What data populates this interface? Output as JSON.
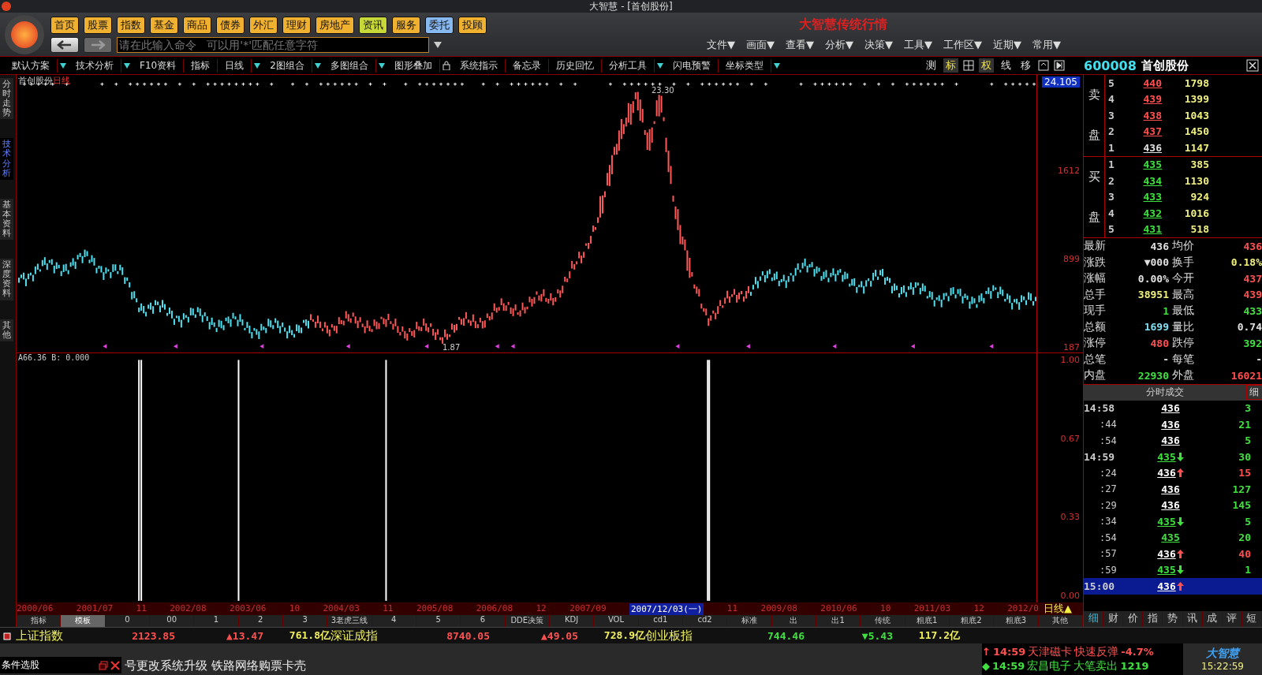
{
  "window": {
    "title": "大智慧 - [首创股份]"
  },
  "banner": "大智慧传统行情",
  "nav": [
    {
      "label": "首页",
      "color": "#f0b030"
    },
    {
      "label": "股票",
      "color": "#f0b030"
    },
    {
      "label": "指数",
      "color": "#f0b030"
    },
    {
      "label": "基金",
      "color": "#f0b030"
    },
    {
      "label": "商品",
      "color": "#f0b030"
    },
    {
      "label": "债券",
      "color": "#f0b030"
    },
    {
      "label": "外汇",
      "color": "#f0b030"
    },
    {
      "label": "理财",
      "color": "#f0b030"
    },
    {
      "label": "房地产",
      "color": "#f0b030"
    },
    {
      "label": "资讯",
      "color": "#c8d838"
    },
    {
      "label": "服务",
      "color": "#f0b030"
    },
    {
      "label": "委托",
      "color": "#88b8f0"
    },
    {
      "label": "投顾",
      "color": "#f0b030"
    }
  ],
  "command": {
    "placeholder": "请在此输入命令   可以用'*'匹配任意字符"
  },
  "menu": [
    "文件▼",
    "画面▼",
    "查看▼",
    "分析▼",
    "决策▼",
    "工具▼",
    "工作区▼",
    "近期▼",
    "常用▼"
  ],
  "toolbar": [
    {
      "label": "默认方案",
      "dropdown": true
    },
    {
      "label": "技术分析",
      "dropdown": true
    },
    {
      "label": "F10资料",
      "dropdown": false
    },
    {
      "label": "指标",
      "dropdown": false
    },
    {
      "label": "日线",
      "dropdown": true
    },
    {
      "label": "2图组合",
      "dropdown": true
    },
    {
      "label": "多图组合",
      "dropdown": true
    },
    {
      "label": "图形叠加",
      "dropdown": false
    },
    {
      "label": "系统指示",
      "dropdown": false
    },
    {
      "label": "备忘录",
      "dropdown": false
    },
    {
      "label": "历史回忆",
      "dropdown": false
    },
    {
      "label": "分析工具",
      "dropdown": true
    },
    {
      "label": "闪电预警",
      "dropdown": false
    },
    {
      "label": "坐标类型",
      "dropdown": true
    }
  ],
  "chart_tools": [
    {
      "label": "测",
      "selected": false
    },
    {
      "label": "标",
      "selected": true
    },
    {
      "label": "权",
      "selected": true
    },
    {
      "label": "线",
      "selected": false
    },
    {
      "label": "移",
      "selected": false
    }
  ],
  "side_tabs": [
    {
      "label": "分时走势",
      "selected": false
    },
    {
      "label": "技术分析",
      "selected": true
    },
    {
      "label": "基本资料",
      "selected": false
    },
    {
      "label": "深度资料",
      "selected": false
    },
    {
      "label": "其他",
      "selected": false
    }
  ],
  "chart": {
    "stock": "首创股份",
    "period": "日线",
    "high_label": "23.30",
    "low_label": "1.87",
    "price_box": "24.105",
    "price_ticks": [
      "1612",
      "899",
      "187"
    ]
  },
  "indicator": {
    "legend": "A66.36 B: 0.000",
    "ticks": [
      "1.00",
      "0.67",
      "0.33",
      "0.00"
    ]
  },
  "dates": [
    {
      "label": "2000/06",
      "selected": false
    },
    {
      "label": "2001/07",
      "selected": false
    },
    {
      "label": "11",
      "selected": false
    },
    {
      "label": "2002/08",
      "selected": false
    },
    {
      "label": "2003/06",
      "selected": false
    },
    {
      "label": "10",
      "selected": false
    },
    {
      "label": "2004/03",
      "selected": false
    },
    {
      "label": "11",
      "selected": false
    },
    {
      "label": "2005/08",
      "selected": false
    },
    {
      "label": "2006/08",
      "selected": false
    },
    {
      "label": "12",
      "selected": false
    },
    {
      "label": "2007/09",
      "selected": false
    },
    {
      "label": "2007/12/03(一)",
      "selected": true
    },
    {
      "label": "11",
      "selected": false
    },
    {
      "label": "2009/08",
      "selected": false
    },
    {
      "label": "2010/06",
      "selected": false
    },
    {
      "label": "10",
      "selected": false
    },
    {
      "label": "2011/03",
      "selected": false
    },
    {
      "label": "12",
      "selected": false
    },
    {
      "label": "2012/0",
      "selected": false
    }
  ],
  "period_label": "日线▲",
  "template_tabs": [
    {
      "label": "指标",
      "selected": false
    },
    {
      "label": "模板",
      "selected": true
    },
    {
      "label": "0",
      "selected": false
    },
    {
      "label": "00",
      "selected": false
    },
    {
      "label": "1",
      "selected": false
    },
    {
      "label": "2",
      "selected": false
    },
    {
      "label": "3",
      "selected": false
    },
    {
      "label": "3老虎三线",
      "selected": false
    },
    {
      "label": "4",
      "selected": false
    },
    {
      "label": "5",
      "selected": false
    },
    {
      "label": "6",
      "selected": false
    },
    {
      "label": "DDE决策",
      "selected": false
    },
    {
      "label": "KDJ",
      "selected": false
    },
    {
      "label": "VOL",
      "selected": false
    },
    {
      "label": "cd1",
      "selected": false
    },
    {
      "label": "cd2",
      "selected": false
    },
    {
      "label": "标准",
      "selected": false
    },
    {
      "label": "出",
      "selected": false
    },
    {
      "label": "出1",
      "selected": false
    },
    {
      "label": "传统",
      "selected": false
    },
    {
      "label": "粗底1",
      "selected": false
    },
    {
      "label": "粗底2",
      "selected": false
    },
    {
      "label": "粗底3",
      "selected": false
    },
    {
      "label": "其他",
      "selected": false
    }
  ],
  "panel": {
    "code": "600008",
    "name": "首创股份",
    "sell_label": [
      "卖",
      "盘"
    ],
    "buy_label": [
      "买",
      "盘"
    ],
    "sell": [
      {
        "level": "5",
        "price": "440",
        "volume": "1798",
        "kind": "up"
      },
      {
        "level": "4",
        "price": "439",
        "volume": "1399",
        "kind": "up"
      },
      {
        "level": "3",
        "price": "438",
        "volume": "1043",
        "kind": "up"
      },
      {
        "level": "2",
        "price": "437",
        "volume": "1450",
        "kind": "up"
      },
      {
        "level": "1",
        "price": "436",
        "volume": "1147",
        "kind": "flat"
      }
    ],
    "buy": [
      {
        "level": "1",
        "price": "435",
        "volume": "385",
        "kind": "down"
      },
      {
        "level": "2",
        "price": "434",
        "volume": "1130",
        "kind": "down"
      },
      {
        "level": "3",
        "price": "433",
        "volume": "924",
        "kind": "down"
      },
      {
        "level": "4",
        "price": "432",
        "volume": "1016",
        "kind": "down"
      },
      {
        "level": "5",
        "price": "431",
        "volume": "518",
        "kind": "down"
      }
    ],
    "stats": [
      {
        "left": {
          "label": "最新",
          "value": "436",
          "kind": "flat"
        },
        "right": {
          "label": "均价",
          "value": "436",
          "kind": "up"
        }
      },
      {
        "left": {
          "label": "涨跌",
          "value": "▼000",
          "kind": "flat"
        },
        "right": {
          "label": "换手",
          "value": "0.18%",
          "kind": "yellow"
        }
      },
      {
        "left": {
          "label": "涨幅",
          "value": "0.00%",
          "kind": "flat"
        },
        "right": {
          "label": "今开",
          "value": "437",
          "kind": "up"
        }
      },
      {
        "left": {
          "label": "总手",
          "value": "38951",
          "kind": "yellow"
        },
        "right": {
          "label": "最高",
          "value": "439",
          "kind": "up"
        }
      },
      {
        "left": {
          "label": "现手",
          "value": "1",
          "kind": "down"
        },
        "right": {
          "label": "最低",
          "value": "433",
          "kind": "down"
        }
      },
      {
        "left": {
          "label": "总额",
          "value": "1699",
          "kind": "cyan"
        },
        "right": {
          "label": "量比",
          "value": "0.74",
          "kind": "flat"
        }
      },
      {
        "left": {
          "label": "涨停",
          "value": "480",
          "kind": "up"
        },
        "right": {
          "label": "跌停",
          "value": "392",
          "kind": "down"
        }
      },
      {
        "left": {
          "label": "总笔",
          "value": "-",
          "kind": "flat"
        },
        "right": {
          "label": "每笔",
          "value": "-",
          "kind": "flat"
        }
      },
      {
        "left": {
          "label": "内盘",
          "value": "22930",
          "kind": "down"
        },
        "right": {
          "label": "外盘",
          "value": "16021",
          "kind": "up"
        }
      }
    ],
    "ticks_title": "分时成交",
    "ticks_btn": "细",
    "ticks": [
      {
        "time": "14:58",
        "full_time": true,
        "price": "436",
        "price_down": false,
        "rising": false,
        "falling": false,
        "volume": "3",
        "volume_up": false,
        "selected": false
      },
      {
        "time": ":44",
        "full_time": false,
        "price": "436",
        "price_down": false,
        "rising": false,
        "falling": false,
        "volume": "21",
        "volume_up": false,
        "selected": false
      },
      {
        "time": ":54",
        "full_time": false,
        "price": "436",
        "price_down": false,
        "rising": false,
        "falling": false,
        "volume": "5",
        "volume_up": false,
        "selected": false
      },
      {
        "time": "14:59",
        "full_time": true,
        "price": "435",
        "price_down": true,
        "rising": false,
        "falling": true,
        "volume": "30",
        "volume_up": false,
        "selected": false
      },
      {
        "time": ":24",
        "full_time": false,
        "price": "436",
        "price_down": false,
        "rising": true,
        "falling": false,
        "volume": "15",
        "volume_up": true,
        "selected": false
      },
      {
        "time": ":27",
        "full_time": false,
        "price": "436",
        "price_down": false,
        "rising": false,
        "falling": false,
        "volume": "127",
        "volume_up": false,
        "selected": false
      },
      {
        "time": ":29",
        "full_time": false,
        "price": "436",
        "price_down": false,
        "rising": false,
        "falling": false,
        "volume": "145",
        "volume_up": false,
        "selected": false
      },
      {
        "time": ":34",
        "full_time": false,
        "price": "435",
        "price_down": true,
        "rising": false,
        "falling": true,
        "volume": "5",
        "volume_up": false,
        "selected": false
      },
      {
        "time": ":54",
        "full_time": false,
        "price": "435",
        "price_down": true,
        "rising": false,
        "falling": false,
        "volume": "20",
        "volume_up": false,
        "selected": false
      },
      {
        "time": ":57",
        "full_time": false,
        "price": "436",
        "price_down": false,
        "rising": true,
        "falling": false,
        "volume": "40",
        "volume_up": true,
        "selected": false
      },
      {
        "time": ":59",
        "full_time": false,
        "price": "435",
        "price_down": true,
        "rising": false,
        "falling": true,
        "volume": "1",
        "volume_up": false,
        "selected": false
      },
      {
        "time": "15:00",
        "full_time": true,
        "price": "436",
        "price_down": false,
        "rising": true,
        "falling": false,
        "selected": true
      }
    ],
    "tabs": [
      {
        "label": "细",
        "selected": true
      },
      {
        "label": "财",
        "selected": false
      },
      {
        "label": "价",
        "selected": false
      },
      {
        "label": "指",
        "selected": false
      },
      {
        "label": "势",
        "selected": false
      },
      {
        "label": "讯",
        "selected": false
      },
      {
        "label": "成",
        "selected": false
      },
      {
        "label": "评",
        "selected": false
      },
      {
        "label": "短",
        "selected": false
      }
    ]
  },
  "ticker": [
    {
      "text": "上证指数",
      "kind": "name"
    },
    {
      "text": "2123.85",
      "kind": "up"
    },
    {
      "text": "▲13.47",
      "kind": "up"
    },
    {
      "text": "761.8亿",
      "kind": "amount"
    },
    {
      "text": "深证成指",
      "kind": "name"
    },
    {
      "text": "8740.05",
      "kind": "up"
    },
    {
      "text": "▲49.05",
      "kind": "up"
    },
    {
      "text": "728.9亿",
      "kind": "amount"
    },
    {
      "text": "创业板指",
      "kind": "name"
    },
    {
      "text": "744.46",
      "kind": "down"
    },
    {
      "text": "▼5.43",
      "kind": "down"
    },
    {
      "text": "117.2亿",
      "kind": "amount"
    }
  ],
  "screener": "条件选股",
  "news": "号更改系统升级 铁路网络购票卡壳",
  "alerts": [
    {
      "mark": "↑",
      "time": "14:59",
      "stock": "天津磁卡",
      "signal": "快速反弹",
      "value": "-4.7%",
      "kind": "up"
    },
    {
      "mark": "◆",
      "time": "14:59",
      "stock": "宏昌电子",
      "signal": "大笔卖出",
      "value": "1219",
      "kind": "down"
    }
  ],
  "logo": "大智慧",
  "clock": "15:22:59"
}
